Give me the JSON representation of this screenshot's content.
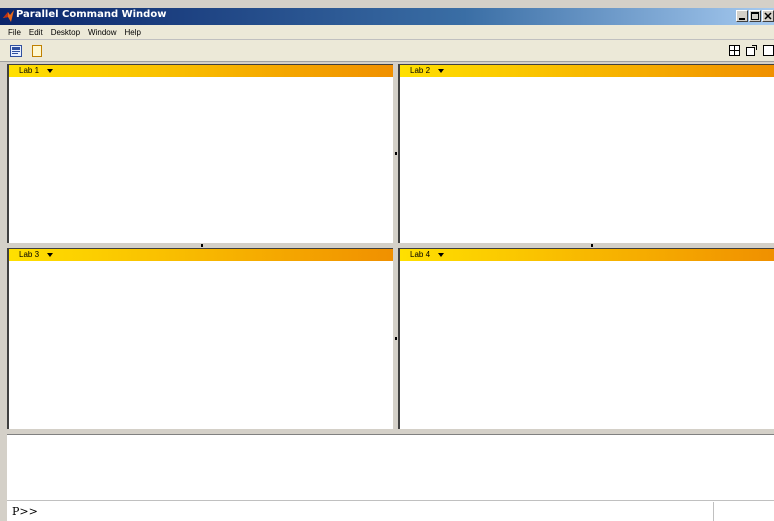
{
  "window": {
    "title": "Parallel Command Window"
  },
  "menu": [
    "File",
    "Edit",
    "Desktop",
    "Window",
    "Help"
  ],
  "toolbar": {
    "left_icons": [
      "command-history-icon",
      "new-document-icon"
    ],
    "right_icons": [
      "tile-layout-icon",
      "undock-icon",
      "maximize-icon"
    ]
  },
  "panes": [
    {
      "label": "Lab 1"
    },
    {
      "label": "Lab 2"
    },
    {
      "label": "Lab 3"
    },
    {
      "label": "Lab 4"
    }
  ],
  "command": {
    "prompt": "P>>"
  },
  "colors": {
    "titlebar": "#0a246a",
    "pane_header_start": "#ffe000",
    "pane_header_end": "#f09000"
  }
}
